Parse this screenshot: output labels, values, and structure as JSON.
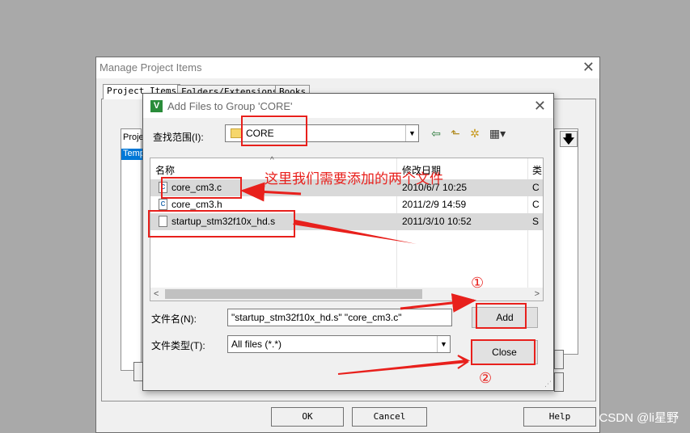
{
  "manage_window": {
    "title": "Manage Project Items",
    "close_glyph": "✕",
    "tabs": [
      "Project Items",
      "Folders/Extensions",
      "Books"
    ],
    "list_header": "Projec",
    "list_selected": "Temp",
    "buttons": {
      "ok": "OK",
      "cancel": "Cancel",
      "help": "Help"
    }
  },
  "dialog": {
    "icon_letter": "V",
    "title": "Add Files to Group 'CORE'",
    "close_glyph": "✕",
    "look_in_label": "查找范围(I):",
    "look_in_value": "CORE",
    "columns": {
      "name": "名称",
      "date": "修改日期",
      "type": "类"
    },
    "files": [
      {
        "name": "core_cm3.c",
        "date": "2010/6/7 10:25",
        "type": "C",
        "selected": true
      },
      {
        "name": "core_cm3.h",
        "date": "2011/2/9 14:59",
        "type": "C",
        "selected": false
      },
      {
        "name": "startup_stm32f10x_hd.s",
        "date": "2011/3/10 10:52",
        "type": "S",
        "selected": true
      }
    ],
    "filename_label": "文件名(N):",
    "filename_value": "\"startup_stm32f10x_hd.s\" \"core_cm3.c\"",
    "filetype_label": "文件类型(T):",
    "filetype_value": "All files (*.*)",
    "add_button": "Add",
    "close_button": "Close"
  },
  "annotations": {
    "note": "这里我们需要添加的两个文件",
    "step1": "①",
    "step2": "②"
  },
  "watermark": "CSDN @li星野",
  "colors": {
    "annotation_red": "#e8201c",
    "selection_blue": "#0078d7"
  }
}
